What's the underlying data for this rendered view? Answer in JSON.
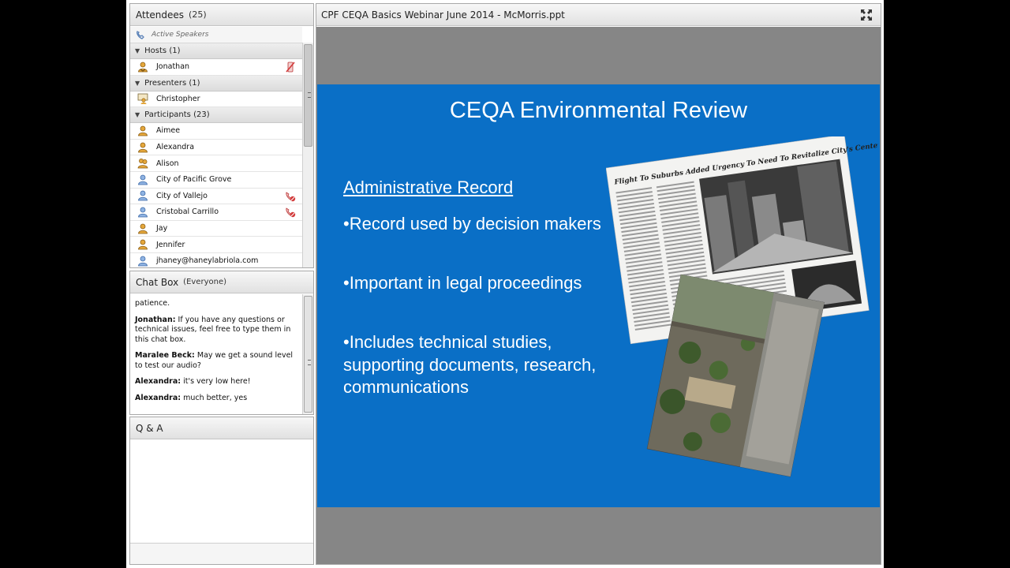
{
  "attendees": {
    "title": "Attendees",
    "count": "(25)",
    "active_speakers": "Active Speakers",
    "hosts": {
      "label": "Hosts (1)",
      "members": [
        {
          "name": "Jonathan"
        }
      ]
    },
    "presenters": {
      "label": "Presenters (1)",
      "members": [
        {
          "name": "Christopher"
        }
      ]
    },
    "participants": {
      "label": "Participants (23)",
      "members": [
        {
          "name": "Aimee"
        },
        {
          "name": "Alexandra"
        },
        {
          "name": "Alison"
        },
        {
          "name": "City of Pacific Grove"
        },
        {
          "name": "City of Vallejo"
        },
        {
          "name": "Cristobal Carrillo"
        },
        {
          "name": "Jay"
        },
        {
          "name": "Jennifer"
        },
        {
          "name": "jhaney@haneylabriola.com"
        }
      ]
    }
  },
  "chat": {
    "title": "Chat Box",
    "scope": "(Everyone)",
    "messages": [
      {
        "author": "",
        "text": "patience."
      },
      {
        "author": "Jonathan:",
        "text": "If you have any questions or technical issues, feel free to type them in this chat box."
      },
      {
        "author": "Maralee Beck:",
        "text": "May we get a sound level to test our audio?"
      },
      {
        "author": "Alexandra:",
        "text": "it's very low here!"
      },
      {
        "author": "Alexandra:",
        "text": "much better, yes"
      }
    ]
  },
  "qa": {
    "title": "Q & A"
  },
  "share": {
    "title": "CPF CEQA Basics Webinar June 2014 - McMorris.ppt",
    "slide": {
      "title": "CEQA Environmental Review",
      "subtitle": "Administrative Record",
      "bullets": [
        "•Record used by decision makers",
        "•Important in legal proceedings",
        "•Includes technical studies, supporting documents, research, communications"
      ],
      "newspaper_headline": "Flight To Suburbs Added Urgency To Need To Revitalize City's Center"
    }
  },
  "colors": {
    "slide_bg": "#0a6fc6",
    "stage_bg": "#868686",
    "user_icon": "#e5a73b",
    "muted_icon": "#d23a3a"
  }
}
